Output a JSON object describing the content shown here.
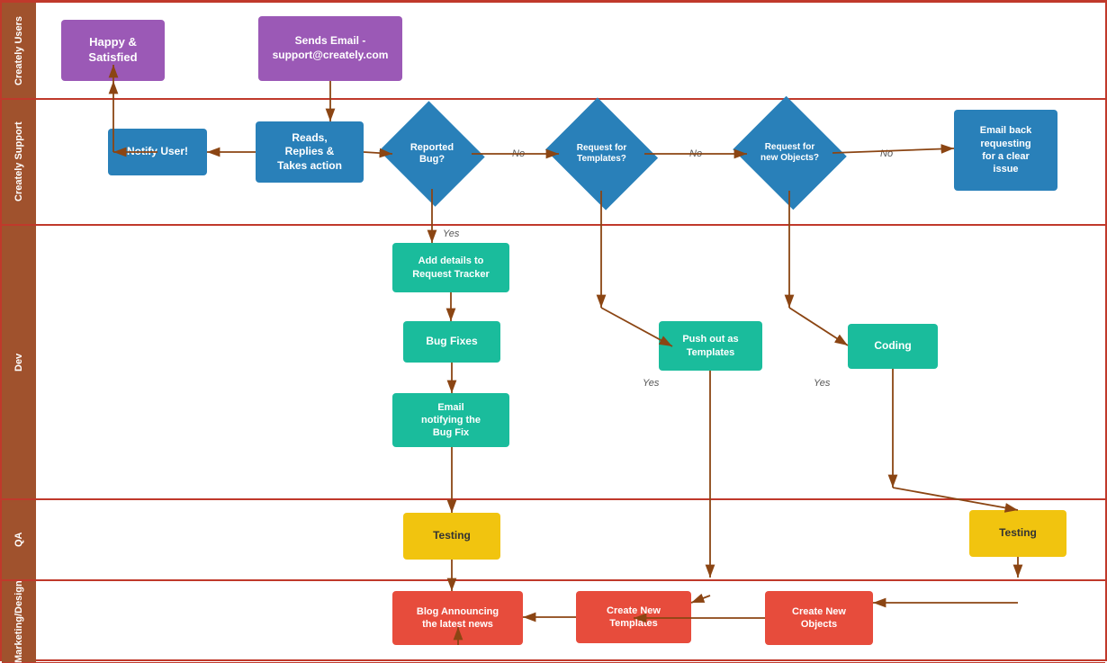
{
  "lanes": [
    {
      "id": "users",
      "label": "Creately Users"
    },
    {
      "id": "support",
      "label": "Creately Support"
    },
    {
      "id": "dev",
      "label": "Dev"
    },
    {
      "id": "qa",
      "label": "QA"
    },
    {
      "id": "marketing",
      "label": "Marketing/Design"
    }
  ],
  "nodes": {
    "happy": "Happy &\nSatisfied",
    "sends_email": "Sends Email -\nsupport@creately.com",
    "notify_user": "Notify User!",
    "reads_replies": "Reads,\nReplies &\nTakes action",
    "reported_bug": "Reported\nBug?",
    "request_templates": "Request for\nTemplates?",
    "request_objects": "Request for\nnew Objects?",
    "email_back": "Email back\nrequesting\nfor a clear\nissue",
    "add_details": "Add details to\nRequest Tracker",
    "bug_fixes": "Bug Fixes",
    "email_notifying": "Email\nnotifying the\nBug Fix",
    "push_templates": "Push out as\nTemplates",
    "coding": "Coding",
    "testing1": "Testing",
    "testing2": "Testing",
    "blog": "Blog Announcing\nthe latest news",
    "create_templates": "Create New\nTemplates",
    "create_objects": "Create New\nObjects",
    "yes": "Yes",
    "no": "No"
  }
}
